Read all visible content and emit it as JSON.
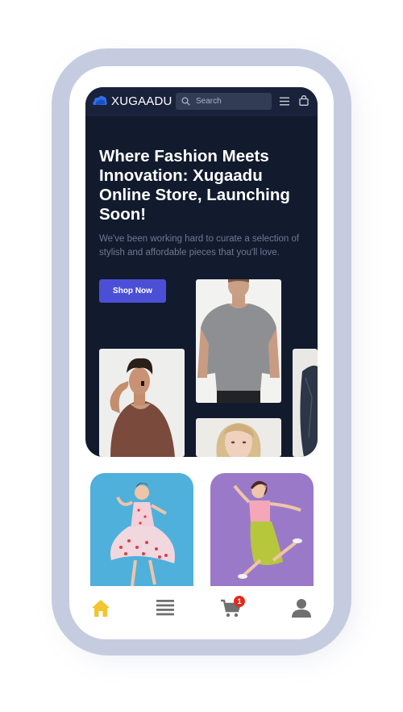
{
  "brand": {
    "name": "XUGAADU",
    "accent_color": "#2f6fe6"
  },
  "search": {
    "placeholder": "Search"
  },
  "header_icons": [
    "menu-icon",
    "shopping-bag-icon"
  ],
  "hero": {
    "title": "Where Fashion Meets Innovation: Xugaadu Online Store, Launching Soon!",
    "description": "We've been working hard to curate a selection of stylish and affordable pieces that you'll love.",
    "cta_label": "Shop Now",
    "cta_color": "#4b4fd6",
    "background_color": "#121a2e"
  },
  "gallery": [
    {
      "name": "man-curly-hair-brown-tshirt-photo"
    },
    {
      "name": "man-grey-tshirt-photo"
    },
    {
      "name": "blonde-woman-portrait-photo"
    },
    {
      "name": "denim-jacket-partial-photo"
    }
  ],
  "product_tiles": [
    {
      "name": "woman-polka-dot-dress-photo",
      "background": "#4fb0dc"
    },
    {
      "name": "woman-pink-top-green-skirt-photo",
      "background": "#9a7ac8"
    }
  ],
  "bottom_nav": {
    "items": [
      {
        "icon": "home-icon",
        "active": true
      },
      {
        "icon": "list-icon",
        "active": false
      },
      {
        "icon": "cart-icon",
        "active": false
      },
      {
        "icon": "user-icon",
        "active": false
      }
    ],
    "active_color": "#f2c531",
    "inactive_color": "#707070",
    "cart_count": "1"
  }
}
